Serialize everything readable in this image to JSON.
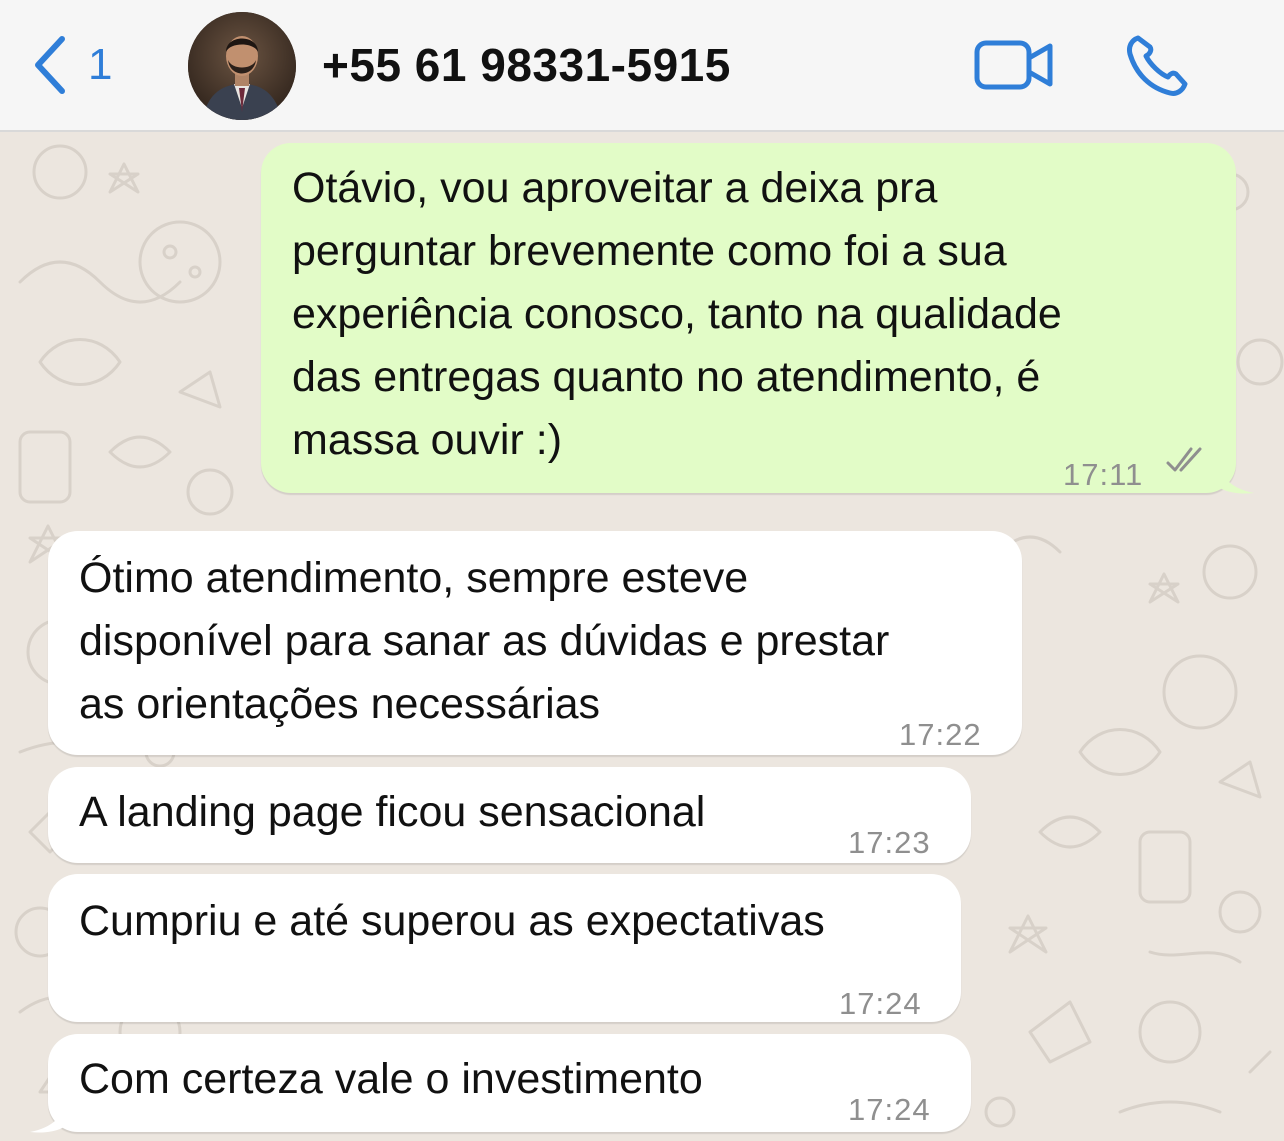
{
  "header": {
    "back_count": "1",
    "contact_name": "+55 61 98331-5915"
  },
  "icons": {
    "back": "chevron-left-icon",
    "video": "video-camera-icon",
    "call": "phone-icon",
    "read_receipt": "double-check-icon"
  },
  "colors": {
    "accent": "#2f7ed8",
    "outgoing_bubble": "#e2fcc7",
    "incoming_bubble": "#ffffff",
    "wallpaper": "#ece6df",
    "timestamp": "#8f8f8f"
  },
  "messages": [
    {
      "direction": "outgoing",
      "text": "Otávio, vou aproveitar a deixa pra\nperguntar brevemente como foi a sua\nexperiência conosco, tanto na qualidade\ndas entregas quanto no atendimento, é\nmassa ouvir :)",
      "time": "17:11",
      "status": "read"
    },
    {
      "direction": "incoming",
      "text": "Ótimo atendimento, sempre esteve\ndisponível para sanar as dúvidas e prestar\nas orientações necessárias",
      "time": "17:22"
    },
    {
      "direction": "incoming",
      "text": "A landing page ficou sensacional",
      "time": "17:23"
    },
    {
      "direction": "incoming",
      "text": "Cumpriu e até superou as expectativas",
      "time": "17:24"
    },
    {
      "direction": "incoming",
      "text": "Com certeza vale o investimento",
      "time": "17:24"
    }
  ]
}
